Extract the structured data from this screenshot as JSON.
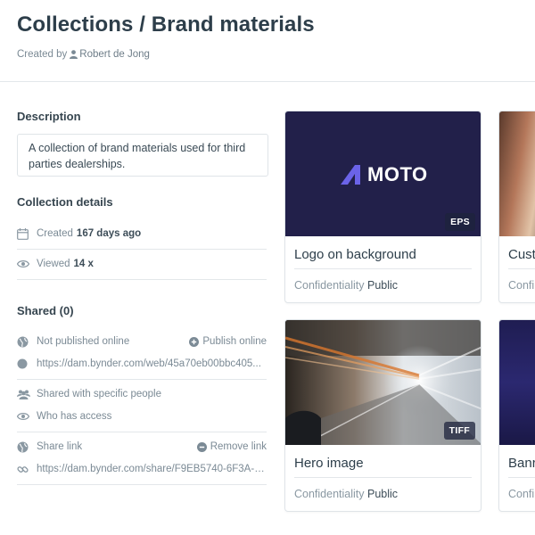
{
  "header": {
    "title": "Collections / Brand materials",
    "created_by_label": "Created by",
    "owner": "Robert de Jong"
  },
  "description": {
    "title": "Description",
    "text": "A collection of brand materials used for third parties dealerships."
  },
  "details": {
    "title": "Collection details",
    "created_label": "Created",
    "created_value": "167 days ago",
    "viewed_label": "Viewed",
    "viewed_value": "14 x"
  },
  "shared": {
    "title": "Shared (0)",
    "not_published": "Not published online",
    "publish_action": "Publish online",
    "publish_url": "https://dam.bynder.com/web/45a70eb00bbc405...",
    "specific_people": "Shared with specific people",
    "who_has_access": "Who has access",
    "share_link_label": "Share link",
    "remove_link": "Remove link",
    "share_url": "https://dam.bynder.com/share/F9EB5740-6F3A-4..."
  },
  "assets": [
    {
      "name": "Logo on background",
      "badge": "EPS",
      "conf_label": "Confidentiality",
      "conf_value": "Public",
      "logo_text": "MOTO"
    },
    {
      "name": "Cust",
      "conf_label": "Confi"
    },
    {
      "name": "Hero image",
      "badge": "TIFF",
      "conf_label": "Confidentiality",
      "conf_value": "Public"
    },
    {
      "name": "Banr",
      "conf_label": "Confi"
    }
  ],
  "colors": {
    "logo_bg": "#22204a",
    "logo_accent": "#6b63e8",
    "text_dark": "#2d3e4a",
    "text_muted": "#7b8a95"
  }
}
